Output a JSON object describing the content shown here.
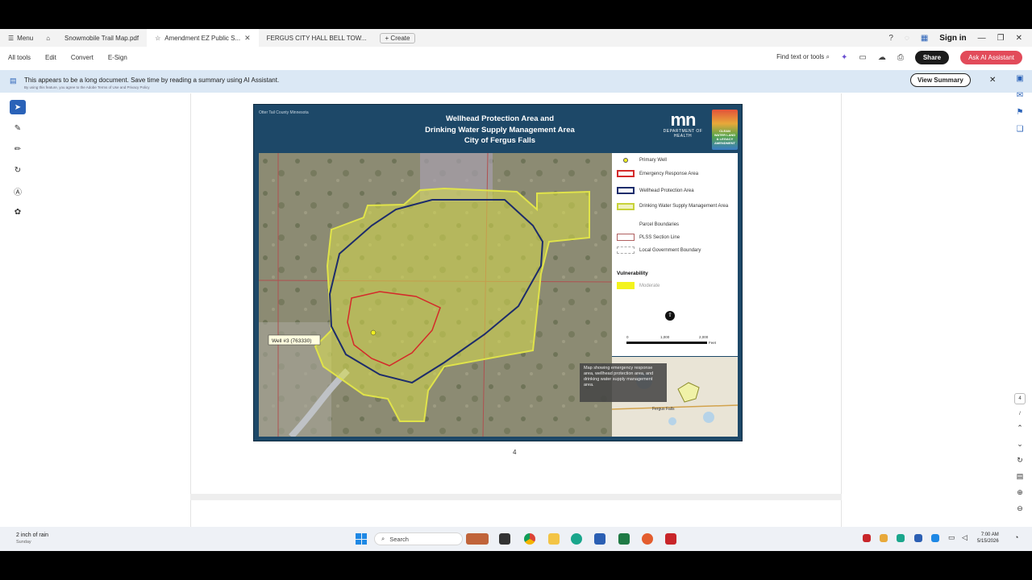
{
  "tabs": {
    "menu": "Menu",
    "items": [
      "Snowmobile Trail Map.pdf",
      "Amendment EZ Public S...",
      "FERGUS CITY HALL BELL TOW..."
    ],
    "create": "Create",
    "sign_in": "Sign in"
  },
  "toolbar": {
    "items": [
      "All tools",
      "Edit",
      "Convert",
      "E-Sign"
    ],
    "find": "Find text or tools",
    "share": "Share",
    "ai": "Ask AI Assistant"
  },
  "banner": {
    "message": "This appears to be a long document. Save time by reading a summary using AI Assistant.",
    "fineprint": "By using this feature, you agree to the Adobe Terms of Use and Privacy Policy",
    "button": "View Summary"
  },
  "figure": {
    "county": "Otter Tail County Minnesota",
    "title_lines": [
      "Wellhead Protection Area and",
      "Drinking Water Supply Management Area",
      "City of Fergus Falls"
    ],
    "logo_mn": "mn",
    "logo_dept": "DEPARTMENT OF HEALTH",
    "clean_water": "CLEAN WATER LAND & LEGACY AMENDMENT",
    "well_label": "Well #3 (763330)",
    "legend": [
      {
        "label": "Primary Well",
        "color": "#f0f020"
      },
      {
        "label": "Emergency Response Area",
        "color": "#d42a2a"
      },
      {
        "label": "Wellhead Protection Area",
        "color": "#1d2c6b"
      },
      {
        "label": "Drinking Water Supply Management Area",
        "color": "#c8d23a"
      },
      {
        "label": "Parcel Boundaries",
        "color": "#999999"
      },
      {
        "label": "PLSS Section Line",
        "color": "#b06060"
      },
      {
        "label": "Local Government Boundary",
        "color": "#aaaaaa"
      }
    ],
    "vulnerability_title": "Vulnerability",
    "vulnerability_level": "Moderate",
    "scale_ticks": [
      "0",
      "1,000",
      "2,000"
    ],
    "scale_unit": "Feet",
    "inset_label": "Fergus Falls"
  },
  "tooltip": "Map showing emergency response area, wellhead protection area, and drinking water supply management area.",
  "page_number": "4",
  "taskbar": {
    "weather_title": "2 inch of rain",
    "weather_sub": "Sunday",
    "search": "Search",
    "time": "7:00 AM",
    "date": "5/15/2026"
  }
}
